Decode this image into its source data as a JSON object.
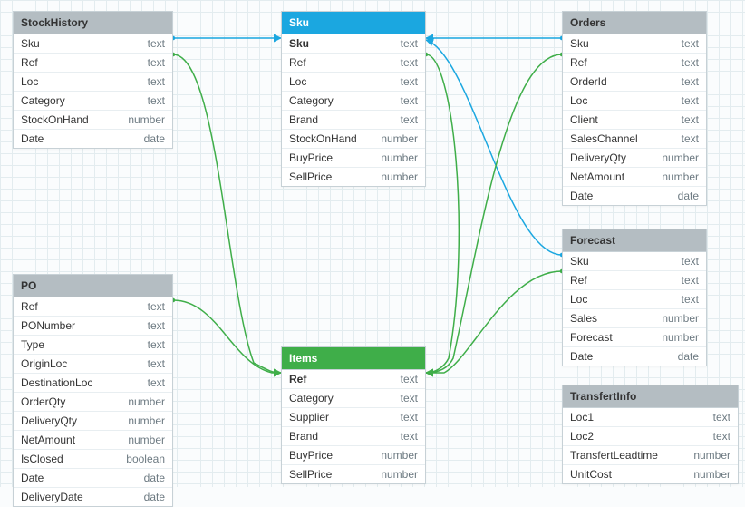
{
  "tables": {
    "stockHistory": {
      "title": "StockHistory",
      "cols": [
        {
          "name": "Sku",
          "type": "text"
        },
        {
          "name": "Ref",
          "type": "text"
        },
        {
          "name": "Loc",
          "type": "text"
        },
        {
          "name": "Category",
          "type": "text"
        },
        {
          "name": "StockOnHand",
          "type": "number"
        },
        {
          "name": "Date",
          "type": "date"
        }
      ]
    },
    "sku": {
      "title": "Sku",
      "cols": [
        {
          "name": "Sku",
          "type": "text",
          "bold": true
        },
        {
          "name": "Ref",
          "type": "text"
        },
        {
          "name": "Loc",
          "type": "text"
        },
        {
          "name": "Category",
          "type": "text"
        },
        {
          "name": "Brand",
          "type": "text"
        },
        {
          "name": "StockOnHand",
          "type": "number"
        },
        {
          "name": "BuyPrice",
          "type": "number"
        },
        {
          "name": "SellPrice",
          "type": "number"
        }
      ]
    },
    "orders": {
      "title": "Orders",
      "cols": [
        {
          "name": "Sku",
          "type": "text"
        },
        {
          "name": "Ref",
          "type": "text"
        },
        {
          "name": "OrderId",
          "type": "text"
        },
        {
          "name": "Loc",
          "type": "text"
        },
        {
          "name": "Client",
          "type": "text"
        },
        {
          "name": "SalesChannel",
          "type": "text"
        },
        {
          "name": "DeliveryQty",
          "type": "number"
        },
        {
          "name": "NetAmount",
          "type": "number"
        },
        {
          "name": "Date",
          "type": "date"
        }
      ]
    },
    "po": {
      "title": "PO",
      "cols": [
        {
          "name": "Ref",
          "type": "text"
        },
        {
          "name": "PONumber",
          "type": "text"
        },
        {
          "name": "Type",
          "type": "text"
        },
        {
          "name": "OriginLoc",
          "type": "text"
        },
        {
          "name": "DestinationLoc",
          "type": "text"
        },
        {
          "name": "OrderQty",
          "type": "number"
        },
        {
          "name": "DeliveryQty",
          "type": "number"
        },
        {
          "name": "NetAmount",
          "type": "number"
        },
        {
          "name": "IsClosed",
          "type": "boolean"
        },
        {
          "name": "Date",
          "type": "date"
        },
        {
          "name": "DeliveryDate",
          "type": "date"
        }
      ]
    },
    "items": {
      "title": "Items",
      "cols": [
        {
          "name": "Ref",
          "type": "text",
          "bold": true
        },
        {
          "name": "Category",
          "type": "text"
        },
        {
          "name": "Supplier",
          "type": "text"
        },
        {
          "name": "Brand",
          "type": "text"
        },
        {
          "name": "BuyPrice",
          "type": "number"
        },
        {
          "name": "SellPrice",
          "type": "number"
        }
      ]
    },
    "forecast": {
      "title": "Forecast",
      "cols": [
        {
          "name": "Sku",
          "type": "text"
        },
        {
          "name": "Ref",
          "type": "text"
        },
        {
          "name": "Loc",
          "type": "text"
        },
        {
          "name": "Sales",
          "type": "number"
        },
        {
          "name": "Forecast",
          "type": "number"
        },
        {
          "name": "Date",
          "type": "date"
        }
      ]
    },
    "transfertInfo": {
      "title": "TransfertInfo",
      "cols": [
        {
          "name": "Loc1",
          "type": "text"
        },
        {
          "name": "Loc2",
          "type": "text"
        },
        {
          "name": "TransfertLeadtime",
          "type": "number"
        },
        {
          "name": "UnitCost",
          "type": "number"
        }
      ]
    }
  },
  "colors": {
    "linkBlue": "#1ba7e0",
    "linkGreen": "#3fae49"
  },
  "chart_data": {
    "type": "table",
    "description": "Entity-relationship diagram of 7 tables with foreign-key links",
    "entities": [
      "StockHistory",
      "Sku",
      "Orders",
      "PO",
      "Items",
      "Forecast",
      "TransfertInfo"
    ],
    "links": [
      {
        "from": "StockHistory.Sku",
        "to": "Sku.Sku",
        "color": "blue"
      },
      {
        "from": "Orders.Sku",
        "to": "Sku.Sku",
        "color": "blue"
      },
      {
        "from": "Forecast.Sku",
        "to": "Sku.Sku",
        "color": "blue"
      },
      {
        "from": "StockHistory.Ref",
        "to": "Items.Ref",
        "color": "green"
      },
      {
        "from": "Sku.Ref",
        "to": "Items.Ref",
        "color": "green"
      },
      {
        "from": "Orders.Ref",
        "to": "Items.Ref",
        "color": "green"
      },
      {
        "from": "PO.Ref",
        "to": "Items.Ref",
        "color": "green"
      },
      {
        "from": "Forecast.Ref",
        "to": "Items.Ref",
        "color": "green"
      }
    ]
  }
}
